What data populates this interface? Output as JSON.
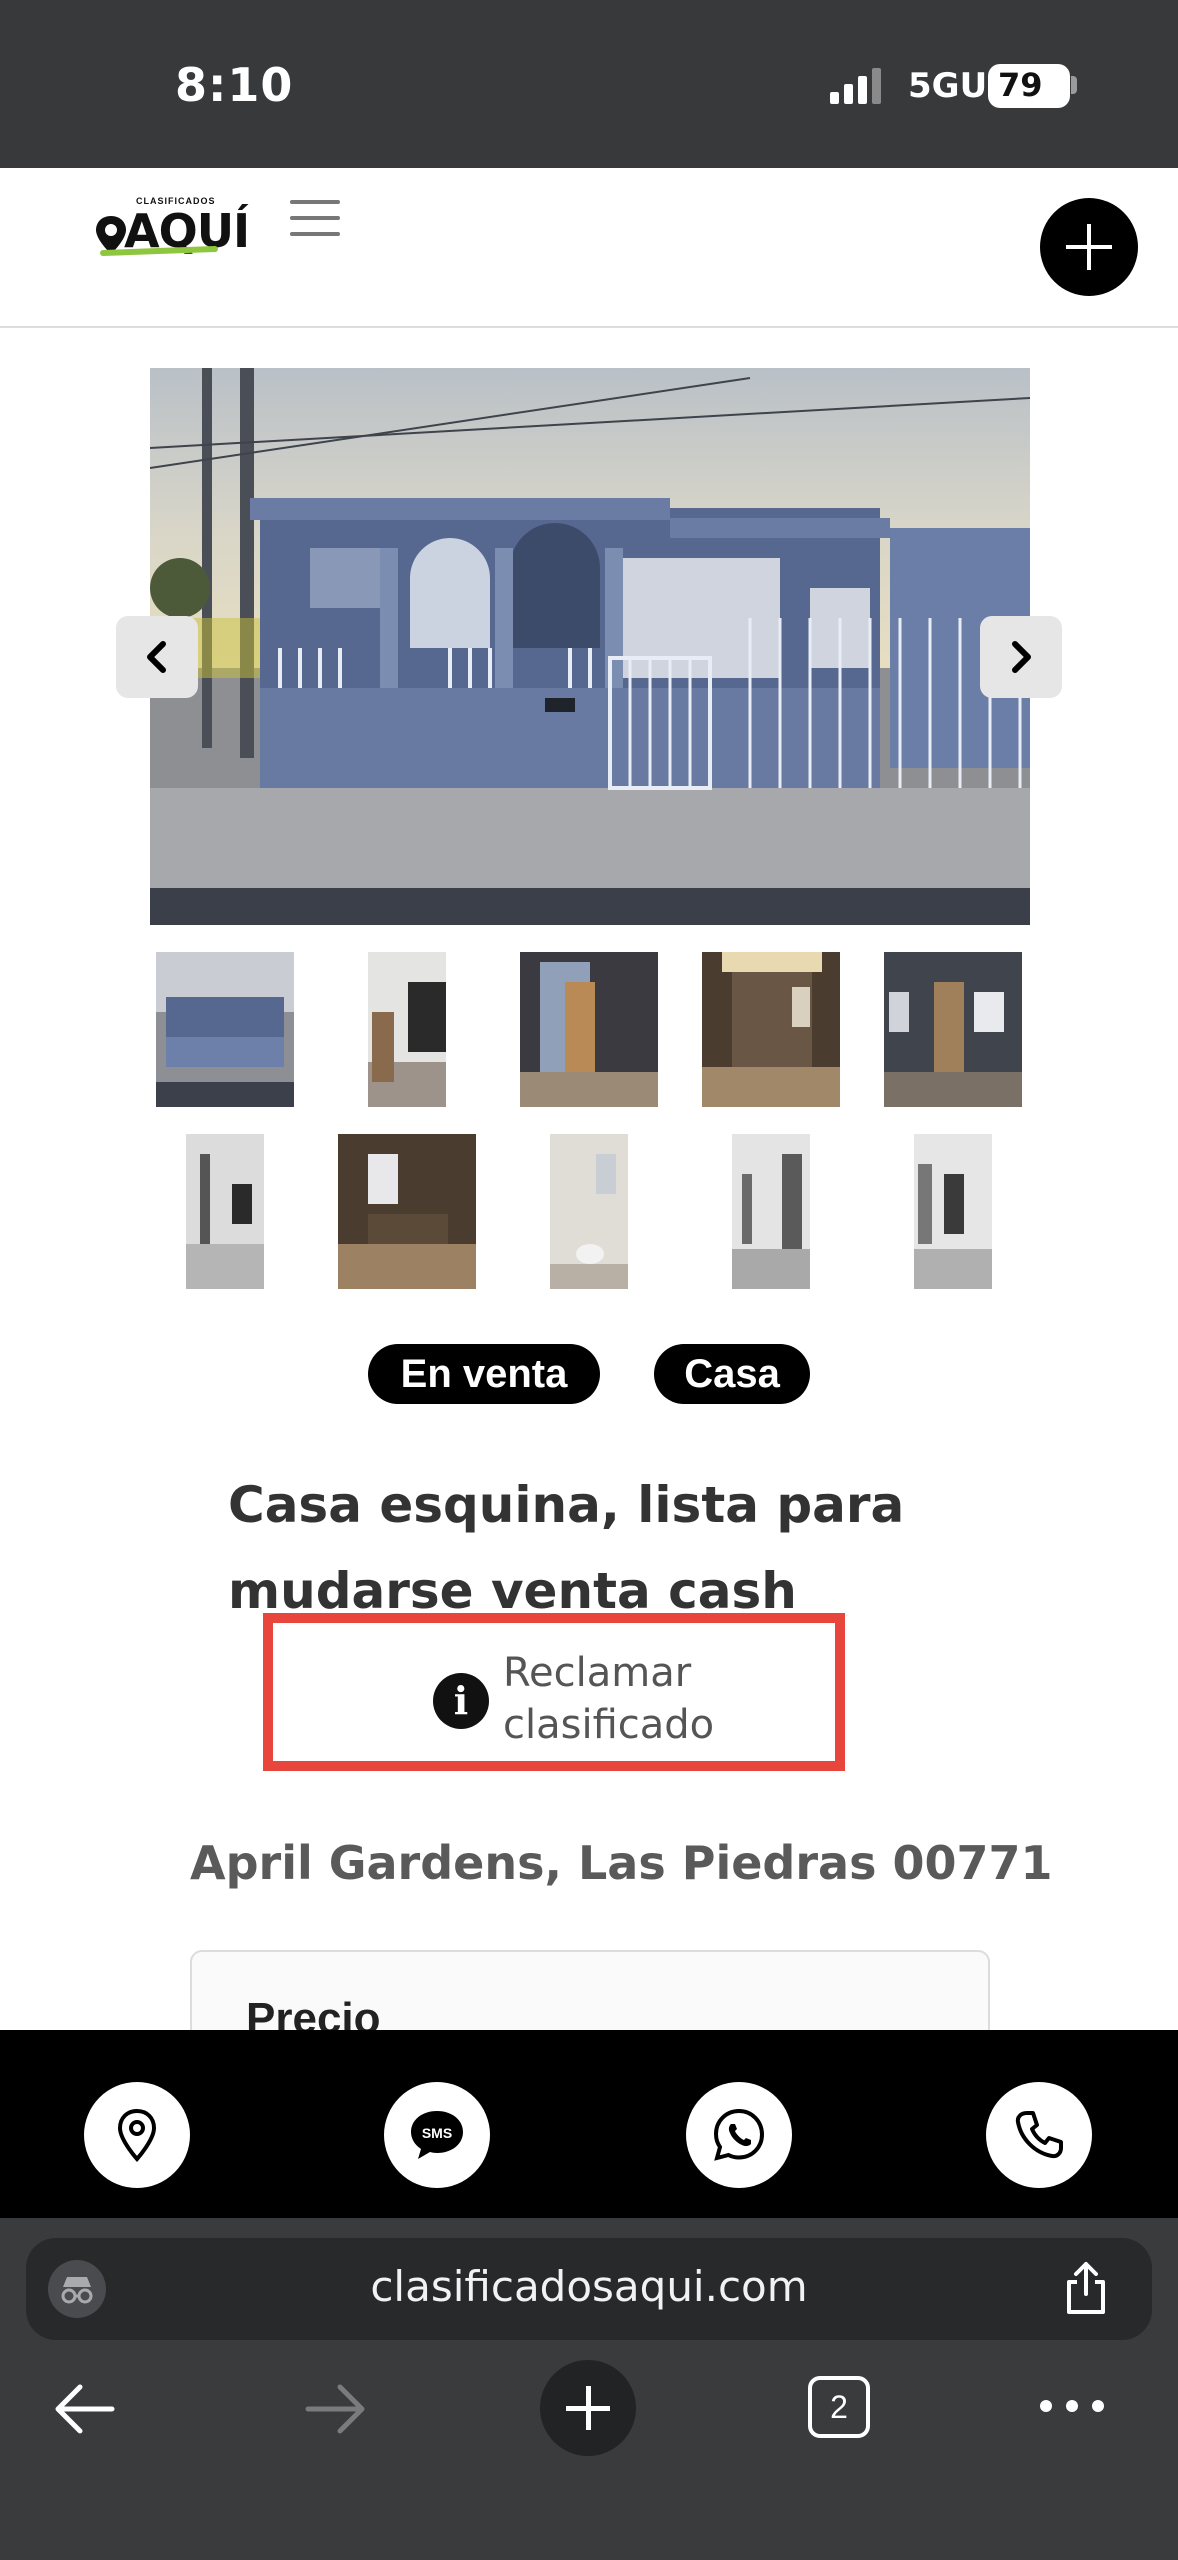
{
  "status_bar": {
    "time": "8:10",
    "network": "5GUC",
    "battery": "79"
  },
  "header": {
    "logo_small": "CLASIFICADOS",
    "logo_big": "AQUÍ",
    "brand_colors": {
      "accent": "#8ec63f",
      "dark": "#111111"
    }
  },
  "gallery": {
    "thumbnail_count": 10
  },
  "tags": [
    "En venta",
    "Casa"
  ],
  "listing": {
    "title": "Casa esquina, lista para mudarse venta cash",
    "title_line1": "Casa esquina, lista para",
    "title_line2": "mudarse venta cash",
    "claim_line1": "Reclamar",
    "claim_line2": "clasificado",
    "location": "April Gardens, Las Piedras 00771",
    "price_label": "Precio"
  },
  "contact": {
    "buttons": [
      "map-pin-icon",
      "sms-icon",
      "whatsapp-icon",
      "phone-icon"
    ],
    "sms_label": "SMS"
  },
  "browser": {
    "url": "clasificadosaqui.com",
    "tab_count": "2"
  },
  "colors": {
    "highlight_border": "#e8453c",
    "tag_bg": "#000000",
    "status_bar_bg": "#38393b"
  }
}
